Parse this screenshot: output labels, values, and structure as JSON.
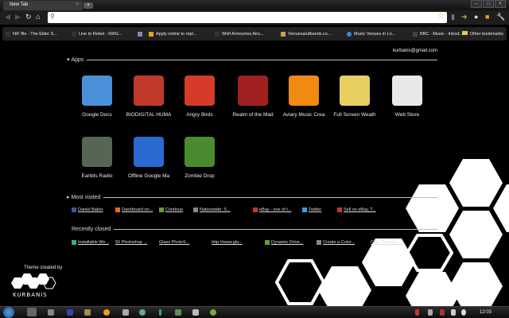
{
  "tab": {
    "title": "New Tab",
    "close": "×",
    "new": "+"
  },
  "window": {
    "min": "–",
    "max": "□",
    "close": "×"
  },
  "bookmarks": [
    {
      "label": "NIF file - The Elder S...",
      "color": "#222"
    },
    {
      "label": "Live to Rebel - SWG...",
      "color": "#333"
    },
    {
      "label": "Apply online to repl...",
      "color": "#e8a020"
    },
    {
      "label": "Wolf Armouries Airs...",
      "color": "#333"
    },
    {
      "label": "Venuesandbands.co...",
      "color": "#c8a050"
    },
    {
      "label": "Music Venues in Lo...",
      "color": "#3a8ad0"
    },
    {
      "label": "BBC - Music - Introd...",
      "color": "#444"
    }
  ],
  "other_bookmarks": "Other bookmarks",
  "email": "kurbanis@gmail.com",
  "apps_heading": "Apps",
  "apps": [
    {
      "label": "Google Docs",
      "color": "#4a90d9"
    },
    {
      "label": "BIODIGITAL HUMA",
      "color": "#c0392b"
    },
    {
      "label": "Angry Birds",
      "color": "#d63b2a"
    },
    {
      "label": "Realm of the Mad",
      "color": "#a02020"
    },
    {
      "label": "Aviary Music Crea",
      "color": "#f08a10"
    },
    {
      "label": "Full Screen Weath",
      "color": "#e8d060"
    },
    {
      "label": "Web Store",
      "color": "#e8e8e8"
    },
    {
      "label": "Earbits Radio",
      "color": "#556655"
    },
    {
      "label": "Offline Google Ma",
      "color": "#2a6ad0"
    },
    {
      "label": "Zombie Drop",
      "color": "#4a8a30"
    }
  ],
  "most_visited_heading": "Most visited",
  "most_visited": [
    {
      "label": "Daniel Baker",
      "color": "#3b5998"
    },
    {
      "label": "Dashboard on...",
      "color": "#e86a20"
    },
    {
      "label": "Continue",
      "color": "#6a9a30"
    },
    {
      "label": "Nationwide: S...",
      "color": "#888"
    },
    {
      "label": "eBay - one of t...",
      "color": "#c33"
    },
    {
      "label": "Twitter",
      "color": "#3aa0e0"
    },
    {
      "label": "Sell on eBay, T...",
      "color": "#c33"
    }
  ],
  "recently_closed_heading": "Recently closed",
  "recently_closed": [
    {
      "label": "Installable We...",
      "color": "#4a8"
    },
    {
      "label": "55 Photoshop ...",
      "color": "#000"
    },
    {
      "label": "Glass PhotoS...",
      "color": "#000"
    },
    {
      "label": "http://www.gla...",
      "color": "#000"
    },
    {
      "label": "Dynamic Drive...",
      "color": "#6a9a30"
    },
    {
      "label": "Create a Color...",
      "color": "#888"
    },
    {
      "label": "Cool Themes |...",
      "color": "#000"
    }
  ],
  "theme_credit": "Theme created by",
  "theme_logo": "KURBANIS",
  "clock": "12:03"
}
